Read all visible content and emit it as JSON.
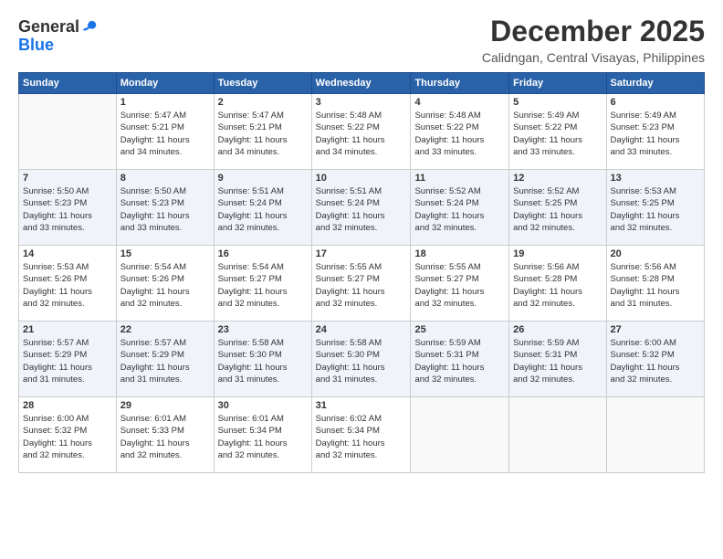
{
  "logo": {
    "general": "General",
    "blue": "Blue"
  },
  "title": {
    "month": "December 2025",
    "location": "Calidngan, Central Visayas, Philippines"
  },
  "header_days": [
    "Sunday",
    "Monday",
    "Tuesday",
    "Wednesday",
    "Thursday",
    "Friday",
    "Saturday"
  ],
  "weeks": [
    [
      {
        "day": "",
        "info": ""
      },
      {
        "day": "1",
        "info": "Sunrise: 5:47 AM\nSunset: 5:21 PM\nDaylight: 11 hours\nand 34 minutes."
      },
      {
        "day": "2",
        "info": "Sunrise: 5:47 AM\nSunset: 5:21 PM\nDaylight: 11 hours\nand 34 minutes."
      },
      {
        "day": "3",
        "info": "Sunrise: 5:48 AM\nSunset: 5:22 PM\nDaylight: 11 hours\nand 34 minutes."
      },
      {
        "day": "4",
        "info": "Sunrise: 5:48 AM\nSunset: 5:22 PM\nDaylight: 11 hours\nand 33 minutes."
      },
      {
        "day": "5",
        "info": "Sunrise: 5:49 AM\nSunset: 5:22 PM\nDaylight: 11 hours\nand 33 minutes."
      },
      {
        "day": "6",
        "info": "Sunrise: 5:49 AM\nSunset: 5:23 PM\nDaylight: 11 hours\nand 33 minutes."
      }
    ],
    [
      {
        "day": "7",
        "info": "Sunrise: 5:50 AM\nSunset: 5:23 PM\nDaylight: 11 hours\nand 33 minutes."
      },
      {
        "day": "8",
        "info": "Sunrise: 5:50 AM\nSunset: 5:23 PM\nDaylight: 11 hours\nand 33 minutes."
      },
      {
        "day": "9",
        "info": "Sunrise: 5:51 AM\nSunset: 5:24 PM\nDaylight: 11 hours\nand 32 minutes."
      },
      {
        "day": "10",
        "info": "Sunrise: 5:51 AM\nSunset: 5:24 PM\nDaylight: 11 hours\nand 32 minutes."
      },
      {
        "day": "11",
        "info": "Sunrise: 5:52 AM\nSunset: 5:24 PM\nDaylight: 11 hours\nand 32 minutes."
      },
      {
        "day": "12",
        "info": "Sunrise: 5:52 AM\nSunset: 5:25 PM\nDaylight: 11 hours\nand 32 minutes."
      },
      {
        "day": "13",
        "info": "Sunrise: 5:53 AM\nSunset: 5:25 PM\nDaylight: 11 hours\nand 32 minutes."
      }
    ],
    [
      {
        "day": "14",
        "info": "Sunrise: 5:53 AM\nSunset: 5:26 PM\nDaylight: 11 hours\nand 32 minutes."
      },
      {
        "day": "15",
        "info": "Sunrise: 5:54 AM\nSunset: 5:26 PM\nDaylight: 11 hours\nand 32 minutes."
      },
      {
        "day": "16",
        "info": "Sunrise: 5:54 AM\nSunset: 5:27 PM\nDaylight: 11 hours\nand 32 minutes."
      },
      {
        "day": "17",
        "info": "Sunrise: 5:55 AM\nSunset: 5:27 PM\nDaylight: 11 hours\nand 32 minutes."
      },
      {
        "day": "18",
        "info": "Sunrise: 5:55 AM\nSunset: 5:27 PM\nDaylight: 11 hours\nand 32 minutes."
      },
      {
        "day": "19",
        "info": "Sunrise: 5:56 AM\nSunset: 5:28 PM\nDaylight: 11 hours\nand 32 minutes."
      },
      {
        "day": "20",
        "info": "Sunrise: 5:56 AM\nSunset: 5:28 PM\nDaylight: 11 hours\nand 31 minutes."
      }
    ],
    [
      {
        "day": "21",
        "info": "Sunrise: 5:57 AM\nSunset: 5:29 PM\nDaylight: 11 hours\nand 31 minutes."
      },
      {
        "day": "22",
        "info": "Sunrise: 5:57 AM\nSunset: 5:29 PM\nDaylight: 11 hours\nand 31 minutes."
      },
      {
        "day": "23",
        "info": "Sunrise: 5:58 AM\nSunset: 5:30 PM\nDaylight: 11 hours\nand 31 minutes."
      },
      {
        "day": "24",
        "info": "Sunrise: 5:58 AM\nSunset: 5:30 PM\nDaylight: 11 hours\nand 31 minutes."
      },
      {
        "day": "25",
        "info": "Sunrise: 5:59 AM\nSunset: 5:31 PM\nDaylight: 11 hours\nand 32 minutes."
      },
      {
        "day": "26",
        "info": "Sunrise: 5:59 AM\nSunset: 5:31 PM\nDaylight: 11 hours\nand 32 minutes."
      },
      {
        "day": "27",
        "info": "Sunrise: 6:00 AM\nSunset: 5:32 PM\nDaylight: 11 hours\nand 32 minutes."
      }
    ],
    [
      {
        "day": "28",
        "info": "Sunrise: 6:00 AM\nSunset: 5:32 PM\nDaylight: 11 hours\nand 32 minutes."
      },
      {
        "day": "29",
        "info": "Sunrise: 6:01 AM\nSunset: 5:33 PM\nDaylight: 11 hours\nand 32 minutes."
      },
      {
        "day": "30",
        "info": "Sunrise: 6:01 AM\nSunset: 5:34 PM\nDaylight: 11 hours\nand 32 minutes."
      },
      {
        "day": "31",
        "info": "Sunrise: 6:02 AM\nSunset: 5:34 PM\nDaylight: 11 hours\nand 32 minutes."
      },
      {
        "day": "",
        "info": ""
      },
      {
        "day": "",
        "info": ""
      },
      {
        "day": "",
        "info": ""
      }
    ]
  ]
}
